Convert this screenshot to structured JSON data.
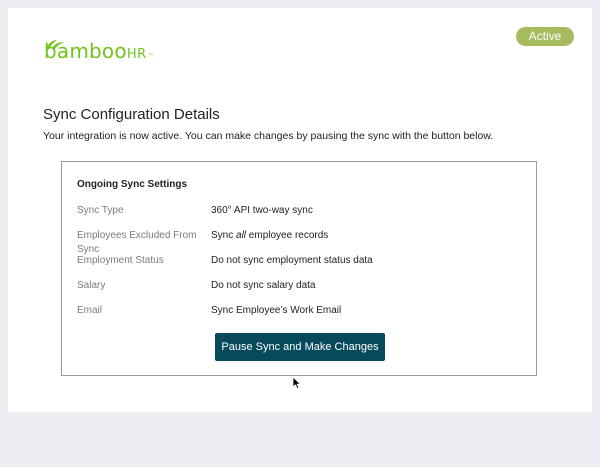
{
  "brand": {
    "logo_main": "bamboo",
    "logo_suffix": "HR",
    "logo_tm": "™",
    "logo_color": "#73c41d"
  },
  "status_badge": {
    "label": "Active",
    "color": "#a5bb5d"
  },
  "page": {
    "title": "Sync Configuration Details",
    "description": "Your integration is now active. You can make changes by pausing the sync with the button below."
  },
  "settings": {
    "heading": "Ongoing Sync Settings",
    "rows": [
      {
        "label": "Sync Type",
        "value": "360° API two-way sync"
      },
      {
        "label": "Employees Excluded From Sync",
        "value_prefix": "Sync ",
        "value_emphasis": "all",
        "value_suffix": " employee records"
      },
      {
        "label": "Employment Status",
        "value": "Do not sync employment status data"
      },
      {
        "label": "Salary",
        "value": "Do not sync salary data"
      },
      {
        "label": "Email",
        "value": "Sync Employee’s Work Email"
      }
    ]
  },
  "actions": {
    "pause_label": "Pause Sync and Make Changes",
    "button_color": "#064a5b"
  },
  "icons": {
    "logo_leaves": "bamboo-leaves-icon",
    "cursor": "mouse-pointer-icon"
  }
}
